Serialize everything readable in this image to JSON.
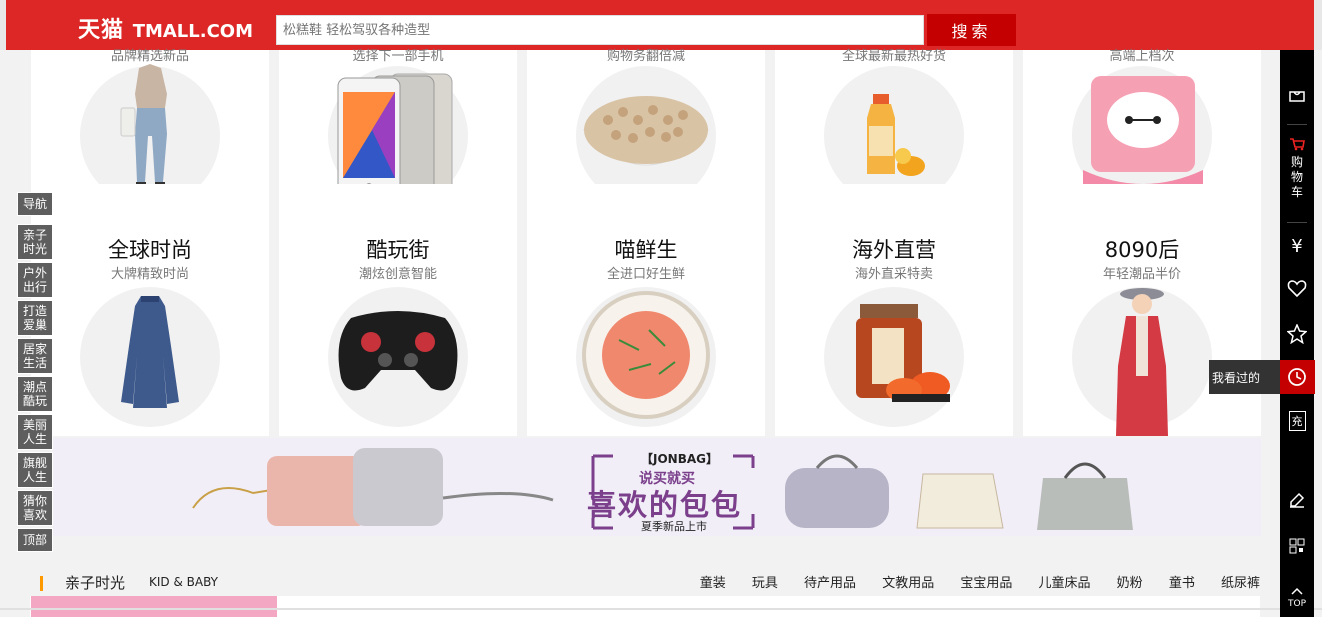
{
  "header": {
    "logo_cn": "天猫",
    "logo_en": "TMALL.COM",
    "search_placeholder": "松糕鞋 轻松驾驭各种造型",
    "search_button": "搜索"
  },
  "tiles_row1": [
    {
      "subtitle": "品牌精选新品",
      "product_icon": "jeans-model-image"
    },
    {
      "subtitle": "选择下一部手机",
      "product_icon": "smartphone-image"
    },
    {
      "subtitle": "购物务翻倍减",
      "product_icon": "barley-bowl-image"
    },
    {
      "subtitle": "全球最新最热好货",
      "product_icon": "juice-bottle-image"
    },
    {
      "subtitle": "高端上档次",
      "product_icon": "baymax-pillow-image"
    }
  ],
  "tiles_row2": [
    {
      "name": "全球时尚",
      "subtitle": "大牌精致时尚",
      "product_icon": "blue-dress-image"
    },
    {
      "name": "酷玩街",
      "subtitle": "潮炫创意智能",
      "product_icon": "gamepad-image"
    },
    {
      "name": "喵鲜生",
      "subtitle": "全进口好生鲜",
      "product_icon": "shrimp-plate-image"
    },
    {
      "name": "海外直营",
      "subtitle": "海外直采特卖",
      "product_icon": "fish-roe-jar-image"
    },
    {
      "name": "8090后",
      "subtitle": "年轻潮品半价",
      "product_icon": "red-coat-model-image"
    }
  ],
  "floor_nav": [
    "导航",
    "亲子时光",
    "户外出行",
    "打造爱巢",
    "居家生活",
    "潮点酷玩",
    "美丽人生",
    "旗舰人生",
    "猜你喜欢",
    "顶部"
  ],
  "right_bar": {
    "cart_label": "购物车",
    "seen_label": "我看过的",
    "charge_label": "充",
    "top_label": "TOP"
  },
  "banner": {
    "brand": "【JONBAG】",
    "slogan": "说买就买",
    "headline": "喜欢的包包",
    "sub": "夏季新品上市"
  },
  "floor": {
    "title": "亲子时光",
    "title_en": "KID & BABY",
    "links": [
      "童装",
      "玩具",
      "待产用品",
      "文教用品",
      "宝宝用品",
      "儿童床品",
      "奶粉",
      "童书",
      "纸尿裤"
    ]
  },
  "colors": {
    "brand_red": "#dd2727",
    "search_button": "#c40000",
    "floor_accent": "#ff9900",
    "banner_purple": "#7b3f8c"
  }
}
